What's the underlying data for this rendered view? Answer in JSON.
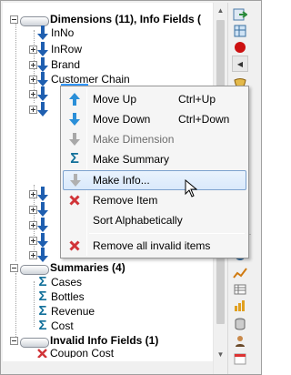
{
  "tree": {
    "groups": {
      "dimensions": "Dimensions (11), Info Fields (",
      "summaries": "Summaries (4)",
      "invalid": "Invalid Info Fields (1)"
    },
    "dimensions": [
      "InNo",
      "InRow",
      "Brand",
      "Customer Chain"
    ],
    "summaries": [
      "Cases",
      "Bottles",
      "Revenue",
      "Cost"
    ],
    "invalid_partial": "Coupon Cost"
  },
  "context_menu": {
    "items": [
      {
        "label": "Move Up",
        "shortcut": "Ctrl+Up",
        "icon": "arrow-up-icon",
        "enabled": true
      },
      {
        "label": "Move Down",
        "shortcut": "Ctrl+Down",
        "icon": "arrow-down-icon",
        "enabled": true
      },
      {
        "label": "Make Dimension",
        "shortcut": "",
        "icon": "arrow-down-gray-icon",
        "enabled": false
      },
      {
        "label": "Make Summary",
        "shortcut": "",
        "icon": "sigma-icon",
        "enabled": true
      },
      {
        "label": "Make Info...",
        "shortcut": "",
        "icon": "arrow-down-gray-icon",
        "enabled": true,
        "hovered": true
      },
      {
        "label": "Remove Item",
        "shortcut": "",
        "icon": "red-x-icon",
        "enabled": true
      },
      {
        "label": "Sort Alphabetically",
        "shortcut": "",
        "icon": "",
        "enabled": true
      },
      {
        "label": "Remove all invalid items",
        "shortcut": "",
        "icon": "red-x-icon",
        "enabled": true
      }
    ]
  },
  "colors": {
    "selection": "#3399ff",
    "menu_hover_border": "#7da2ce",
    "sigma": "#12709a",
    "dimension_arrow": "#1f5fb0"
  }
}
